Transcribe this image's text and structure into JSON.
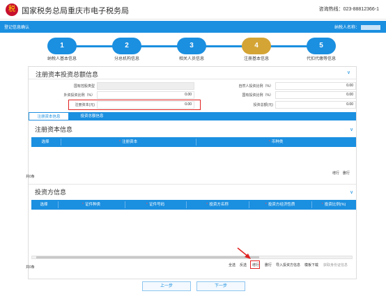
{
  "header": {
    "logo_text": "税",
    "title": "国家税务总局重庆市电子税务局",
    "hotline": "咨询热线：023-88812366-1"
  },
  "bluebar": {
    "left_text": "登记信息确认",
    "right_text": "纳税人名称："
  },
  "steps": [
    {
      "num": "1",
      "label": "纳税人基本信息"
    },
    {
      "num": "2",
      "label": "分总机构信息"
    },
    {
      "num": "3",
      "label": "相关人员信息"
    },
    {
      "num": "4",
      "label": "注册基本信息"
    },
    {
      "num": "5",
      "label": "代扣代缴等信息"
    }
  ],
  "invest_panel": {
    "title": "注册资本投资总额信息",
    "fields": {
      "state_type_label": "国有控股类型",
      "natural_ratio_label": "自然人投资比例（%）",
      "natural_ratio_value": "0.00",
      "foreign_ratio_label": "外资投资比例（%）",
      "foreign_ratio_value": "0.00",
      "state_ratio_label": "国有投资比例（%）",
      "state_ratio_value": "0.00",
      "reg_capital_label": "注册资本(元)",
      "reg_capital_value": "0.00",
      "total_invest_label": "投资总额(元)",
      "total_invest_value": "0.00"
    }
  },
  "tabs": [
    "注册资本信息",
    "投资总额信息"
  ],
  "capital_section": {
    "title": "注册资本信息",
    "columns": [
      "选择",
      "注册资本",
      "币种类"
    ],
    "count": "共0条",
    "add": "增行",
    "delete": "删行"
  },
  "investor_section": {
    "title": "投资方信息",
    "columns": [
      "选择",
      "证件种类",
      "证件号码",
      "投资方名称",
      "投资方经济性质",
      "投资比例(%)"
    ],
    "count": "共0条",
    "toolbar": [
      "全选",
      "反选",
      "增行",
      "删行",
      "导入投资方信息",
      "模板下载",
      "获取身份证信息"
    ]
  },
  "footer": {
    "prev": "上一步",
    "next": "下一步"
  }
}
